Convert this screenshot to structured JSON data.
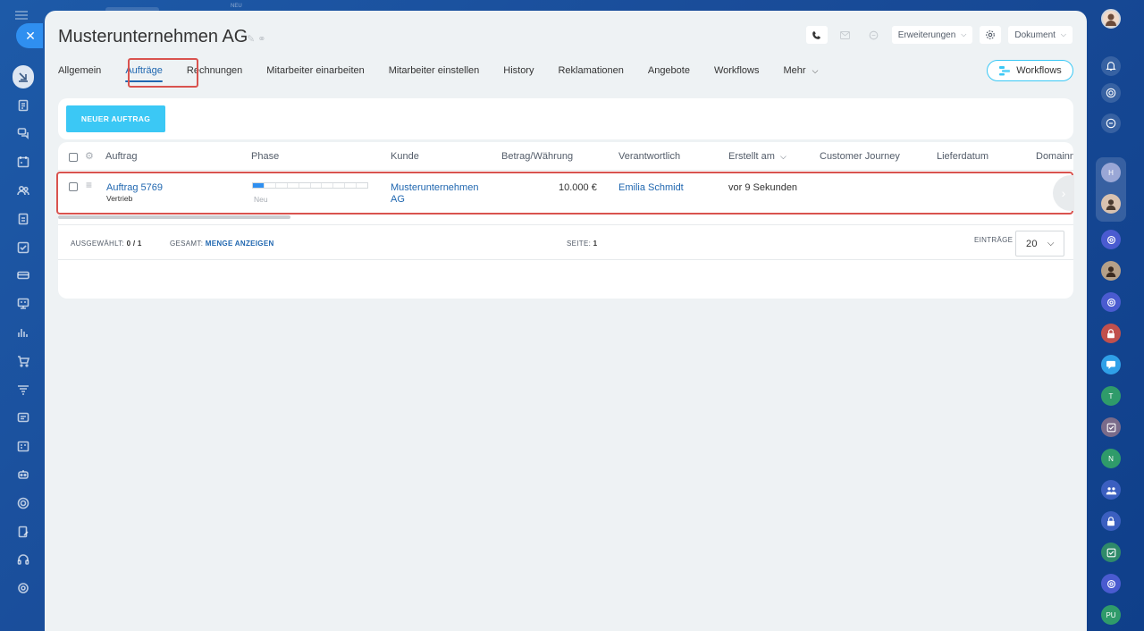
{
  "top_ghost_label": "NEU",
  "title": "Musterunternehmen AG",
  "header": {
    "erweiterungen": "Erweiterungen",
    "dokument": "Dokument"
  },
  "tabs": [
    {
      "label": "Allgemein"
    },
    {
      "label": "Aufträge"
    },
    {
      "label": "Rechnungen"
    },
    {
      "label": "Mitarbeiter einarbeiten"
    },
    {
      "label": "Mitarbeiter einstellen"
    },
    {
      "label": "History"
    },
    {
      "label": "Reklamationen"
    },
    {
      "label": "Angebote"
    },
    {
      "label": "Workflows"
    },
    {
      "label": "Mehr"
    }
  ],
  "workflows_button": "Workflows",
  "new_button": "NEUER AUFTRAG",
  "columns": {
    "auftrag": "Auftrag",
    "phase": "Phase",
    "kunde": "Kunde",
    "betrag": "Betrag/Währung",
    "verantwortlich": "Verantwortlich",
    "erstellt": "Erstellt am",
    "journey": "Customer Journey",
    "lieferdatum": "Lieferdatum",
    "domain": "Domainn"
  },
  "row": {
    "auftrag": "Auftrag 5769",
    "auftrag_sub": "Vertrieb",
    "phase_label": "Neu",
    "phase_progress": 0.1,
    "kunde_line1": "Musterunternehmen",
    "kunde_line2": "AG",
    "betrag": "10.000 €",
    "verantwortlich": "Emilia Schmidt",
    "erstellt": "vor 9 Sekunden"
  },
  "footer": {
    "selected_label": "AUSGEWÄHLT:",
    "selected_value": "0 / 1",
    "total_label": "GESAMT:",
    "total_link": "MENGE ANZEIGEN",
    "page_label": "SEITE:",
    "page_value": "1",
    "entries_label": "EINTRÄGE",
    "entries_value": "20"
  },
  "right_bar_letters": {
    "h": "H",
    "t": "T",
    "n": "N",
    "pu": "PU"
  },
  "colors": {
    "accent": "#3bc8f5",
    "link": "#2067b0",
    "highlight": "#d9534f"
  }
}
